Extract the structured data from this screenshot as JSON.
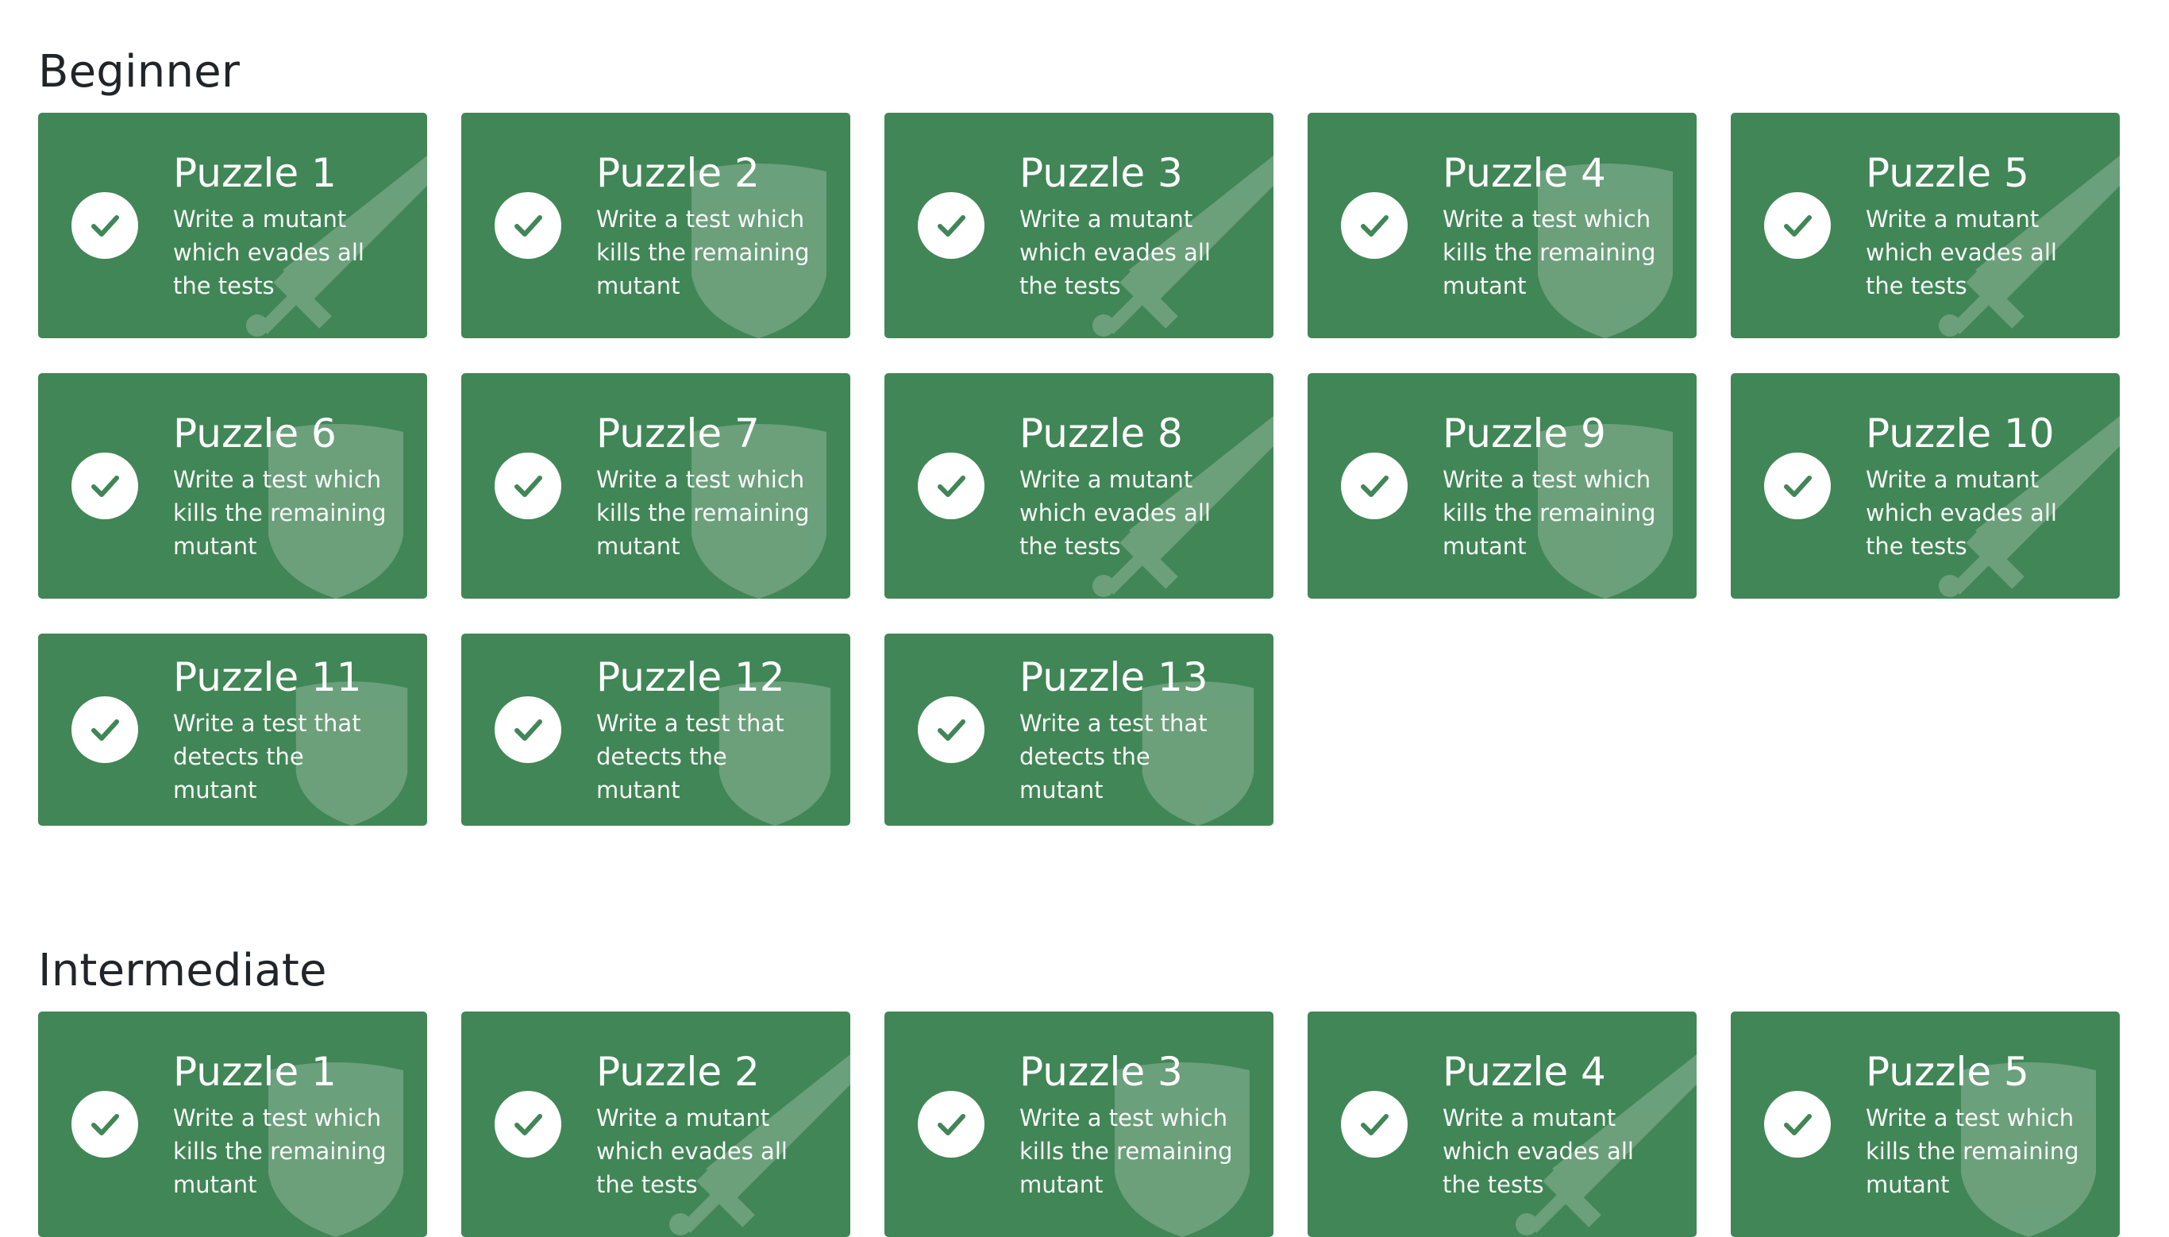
{
  "sections": [
    {
      "title": "Beginner",
      "puzzles": [
        {
          "title": "Puzzle 1",
          "description": "Write a mutant which evades all the tests",
          "icon": "sword-icon"
        },
        {
          "title": "Puzzle 2",
          "description": "Write a test which kills the remaining mutant",
          "icon": "shield-icon"
        },
        {
          "title": "Puzzle 3",
          "description": "Write a mutant which evades all the tests",
          "icon": "sword-icon"
        },
        {
          "title": "Puzzle 4",
          "description": "Write a test which kills the remaining mutant",
          "icon": "shield-icon"
        },
        {
          "title": "Puzzle 5",
          "description": "Write a mutant which evades all the tests",
          "icon": "sword-icon"
        },
        {
          "title": "Puzzle 6",
          "description": "Write a test which kills the remaining mutant",
          "icon": "shield-icon"
        },
        {
          "title": "Puzzle 7",
          "description": "Write a test which kills the remaining mutant",
          "icon": "shield-icon"
        },
        {
          "title": "Puzzle 8",
          "description": "Write a mutant which evades all the tests",
          "icon": "sword-icon"
        },
        {
          "title": "Puzzle 9",
          "description": "Write a test which kills the remaining mutant",
          "icon": "shield-icon"
        },
        {
          "title": "Puzzle 10",
          "description": "Write a mutant which evades all the tests",
          "icon": "sword-icon"
        },
        {
          "title": "Puzzle 11",
          "description": "Write a test that detects the mutant",
          "icon": "shield-icon"
        },
        {
          "title": "Puzzle 12",
          "description": "Write a test that detects the mutant",
          "icon": "shield-icon"
        },
        {
          "title": "Puzzle 13",
          "description": "Write a test that detects the mutant",
          "icon": "shield-icon"
        }
      ]
    },
    {
      "title": "Intermediate",
      "puzzles": [
        {
          "title": "Puzzle 1",
          "description": "Write a test which kills the remaining mutant",
          "icon": "shield-icon"
        },
        {
          "title": "Puzzle 2",
          "description": "Write a mutant which evades all the tests",
          "icon": "sword-icon"
        },
        {
          "title": "Puzzle 3",
          "description": "Write a test which kills the remaining mutant",
          "icon": "shield-icon"
        },
        {
          "title": "Puzzle 4",
          "description": "Write a mutant which evades all the tests",
          "icon": "sword-icon"
        },
        {
          "title": "Puzzle 5",
          "description": "Write a test which kills the remaining mutant",
          "icon": "shield-icon"
        }
      ]
    }
  ],
  "status_icon": "check-circle-icon",
  "colors": {
    "card_background": "#418656",
    "check_background": "#ffffff",
    "check_mark": "#418656",
    "text": "#ffffff",
    "heading": "#212529"
  }
}
